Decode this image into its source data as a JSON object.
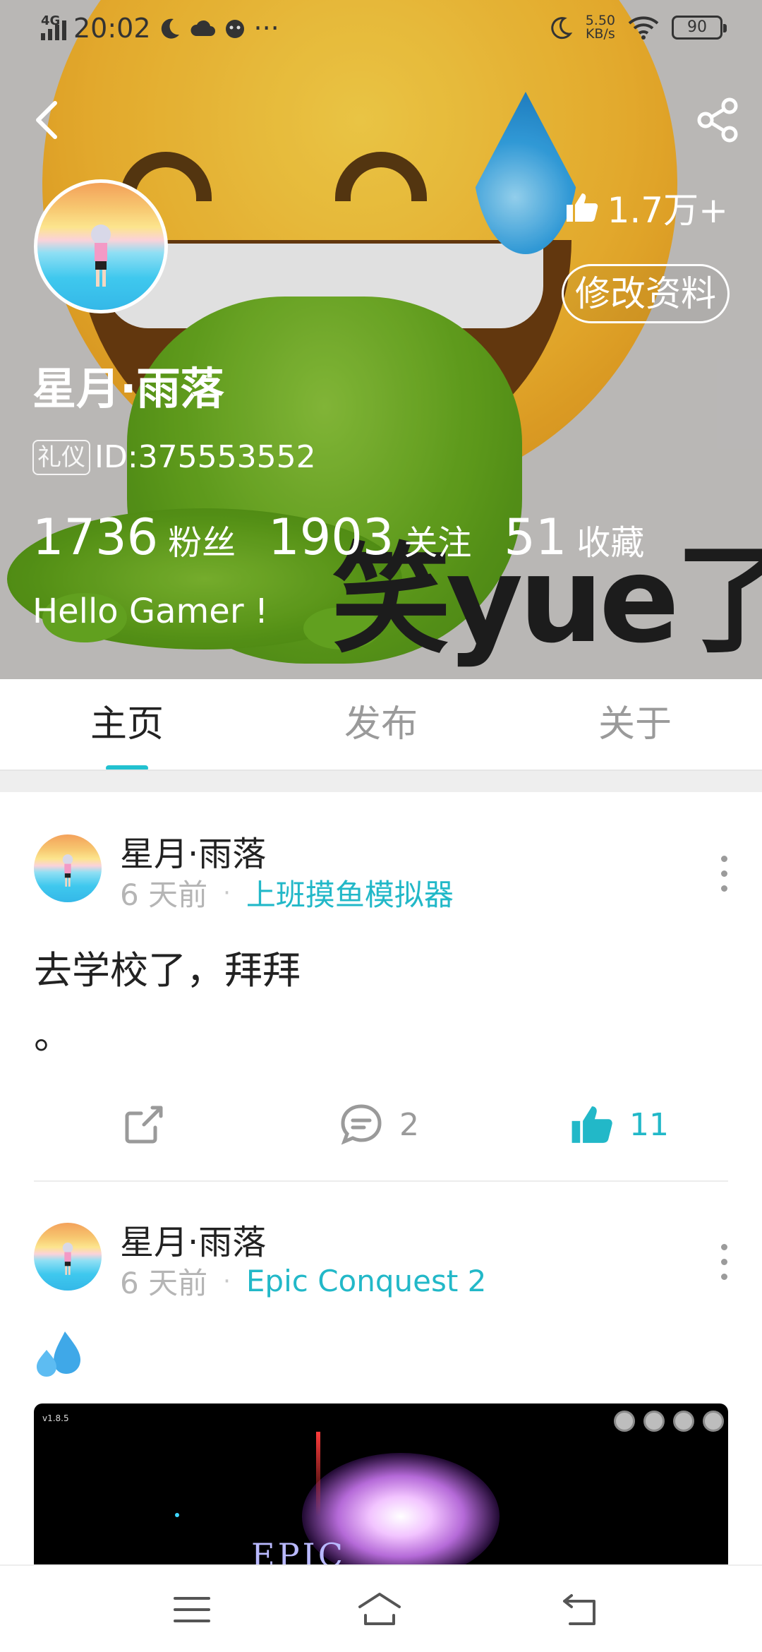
{
  "status_bar": {
    "network": "4G",
    "time": "20:02",
    "more": "···",
    "speed": "5.50",
    "speed_unit": "KB/s",
    "battery": "90"
  },
  "profile": {
    "likes": "1.7万+",
    "edit_label": "修改资料",
    "nickname": "星月·雨落",
    "tag": "礼仪",
    "id_text": "ID:375553552",
    "stats": [
      {
        "value": "1736",
        "label": "粉丝"
      },
      {
        "value": "1903",
        "label": "关注"
      },
      {
        "value": "51",
        "label": "收藏"
      }
    ],
    "bio": "Hello Gamer !",
    "cover_sticker_text": "笑yue了"
  },
  "tabs": [
    {
      "label": "主页",
      "active": true
    },
    {
      "label": "发布",
      "active": false
    },
    {
      "label": "关于",
      "active": false
    }
  ],
  "posts": [
    {
      "author": "星月·雨落",
      "time": "6 天前",
      "separator": "·",
      "game": "上班摸鱼模拟器",
      "text_line1": "去学校了，拜拜",
      "text_line2": "。",
      "comments": "2",
      "likes": "11"
    },
    {
      "author": "星月·雨落",
      "time": "6 天前",
      "separator": "·",
      "game": "Epic Conquest 2",
      "emoji": "sweat-droplets-icon",
      "image": {
        "version": "v1.8.5",
        "title_fragment": "EPIC"
      }
    }
  ],
  "colors": {
    "accent": "#22c1d0",
    "link": "#22b8c8",
    "muted": "#9a9a9a"
  },
  "icons": [
    "back-icon",
    "share-icon",
    "thumbs-up-icon",
    "more-icon",
    "comment-icon",
    "menu-icon",
    "home-icon",
    "return-icon"
  ]
}
